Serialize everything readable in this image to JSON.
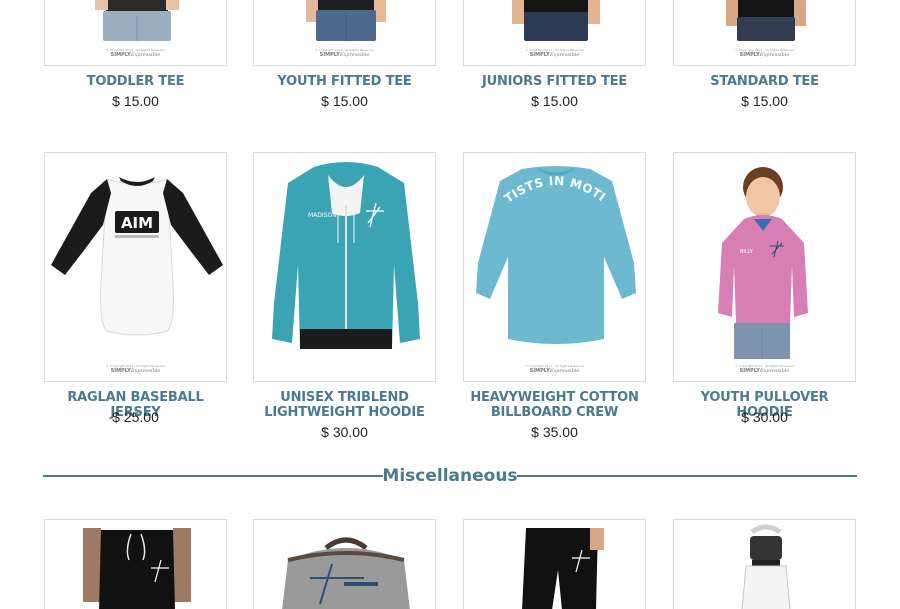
{
  "products_row1": [
    {
      "name": "TODDLER TEE",
      "price": "$ 15.00"
    },
    {
      "name": "YOUTH FITTED TEE",
      "price": "$ 15.00"
    },
    {
      "name": "JUNIORS FITTED TEE",
      "price": "$ 15.00"
    },
    {
      "name": "STANDARD TEE",
      "price": "$ 15.00"
    }
  ],
  "products_row2": [
    {
      "name": "RAGLAN BASEBALL JERSEY",
      "price": "$ 25.00"
    },
    {
      "name": "UNISEX TRIBLEND LIGHTWEIGHT HOODIE",
      "price": "$ 30.00"
    },
    {
      "name": "HEAVYWEIGHT COTTON BILLBOARD CREW",
      "price": "$ 35.00"
    },
    {
      "name": "YOUTH PULLOVER HOODIE",
      "price": "$ 30.00"
    }
  ],
  "section": {
    "title": "Miscellaneous"
  },
  "image_text": {
    "copyright": "© Copyright 2017 · All Rights Reserved",
    "brand_prefix": "SIMPLY",
    "brand_suffix": "Expressible",
    "jersey_logo": "AIM",
    "hoodie_name": "MADISON",
    "crew_print": "ARTISTS IN MOTION",
    "youth_name": "BILLY"
  },
  "colors": {
    "accent": "#4a7a92",
    "teal_garment": "#3aa3b4",
    "light_blue_garment": "#6db9cf",
    "pink_garment": "#d77fb5"
  }
}
